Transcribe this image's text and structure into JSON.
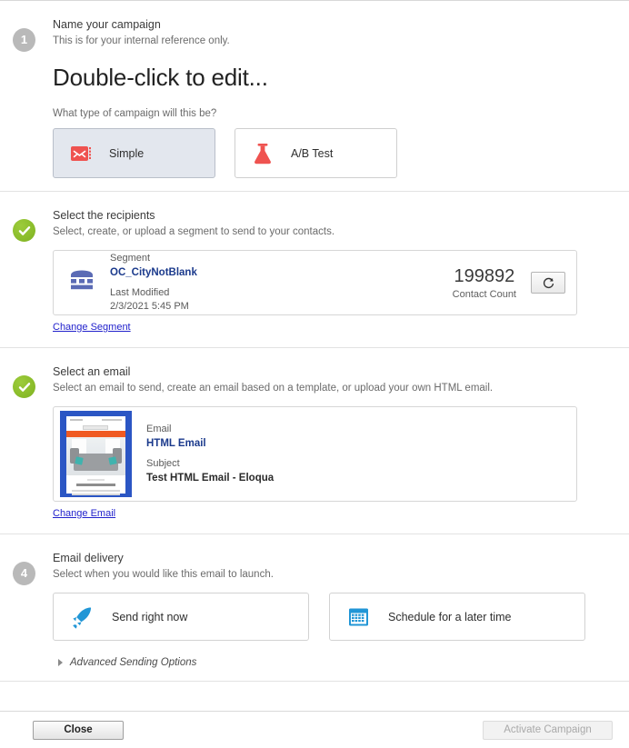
{
  "steps": {
    "name_campaign": {
      "badge": "1",
      "badge_type": "number",
      "title": "Name your campaign",
      "subtitle": "This is for your internal reference only.",
      "campaign_name": "Double-click to edit...",
      "type_question": "What type of campaign will this be?",
      "options": [
        {
          "label": "Simple",
          "icon": "email-envelope-icon",
          "selected": true
        },
        {
          "label": "A/B Test",
          "icon": "flask-icon",
          "selected": false
        }
      ]
    },
    "recipients": {
      "badge": "check",
      "badge_type": "check",
      "title": "Select the recipients",
      "subtitle": "Select, create, or upload a segment to send to your contacts.",
      "segment": {
        "type_label": "Segment",
        "name": "OC_CityNotBlank",
        "modified_label": "Last Modified",
        "modified_value": "2/3/2021 5:45 PM",
        "contact_count": "199892",
        "contact_count_label": "Contact Count",
        "refresh_icon": "refresh-icon"
      },
      "change_link": "Change Segment"
    },
    "email": {
      "badge": "check",
      "badge_type": "check",
      "title": "Select an email",
      "subtitle": "Select an email to send, create an email based on a template, or upload your own HTML email.",
      "asset": {
        "type_label": "Email",
        "name": "HTML Email",
        "subject_label": "Subject",
        "subject_value": "Test HTML Email - Eloqua",
        "thumbnail": "email-preview-thumbnail"
      },
      "change_link": "Change Email"
    },
    "delivery": {
      "badge": "4",
      "badge_type": "number",
      "title": "Email delivery",
      "subtitle": "Select when you would like this email to launch.",
      "options": [
        {
          "label": "Send right now",
          "icon": "rocket-icon",
          "selected": false
        },
        {
          "label": "Schedule for a later time",
          "icon": "calendar-icon",
          "selected": false
        }
      ],
      "advanced_label": "Advanced Sending Options",
      "advanced_expanded": false
    }
  },
  "footer": {
    "close_label": "Close",
    "activate_label": "Activate Campaign",
    "activate_disabled": true
  },
  "colors": {
    "accent_red": "#ef5350",
    "accent_blue": "#2196d6",
    "segment_blue": "#5b6bb5",
    "link_blue": "#2222cc",
    "success_green": "#8cbe2c",
    "badge_gray": "#b9b9b9"
  }
}
